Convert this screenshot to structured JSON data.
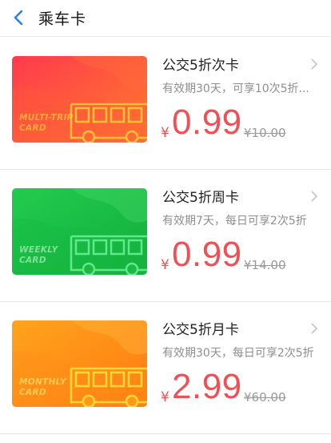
{
  "header": {
    "title": "乘车卡"
  },
  "cards": [
    {
      "name": "公交5折次卡",
      "description": "有效期30天，可享10次5折...",
      "currency": "¥",
      "price": "0.99",
      "original_price": "¥10.00",
      "card_label": "MULTI-TRIP\nCARD",
      "colors": {
        "start": "#ff3f4c",
        "end": "#ff7b2a",
        "bus": "#ffd23a",
        "label": "#ffdd3c"
      }
    },
    {
      "name": "公交5折周卡",
      "description": "有效期7天，每日可享2次5折",
      "currency": "¥",
      "price": "0.99",
      "original_price": "¥14.00",
      "card_label": "WEEKLY\nCARD",
      "colors": {
        "start": "#1ec94b",
        "end": "#15b23e",
        "bus": "#6df29a",
        "label": "#b8f7c9"
      }
    },
    {
      "name": "公交5折月卡",
      "description": "有效期30天，每日可享2次5折",
      "currency": "¥",
      "price": "2.99",
      "original_price": "¥60.00",
      "card_label": "MONTHLY\nCARD",
      "colors": {
        "start": "#ffa21b",
        "end": "#ff7d12",
        "bus": "#ffe13a",
        "label": "#fff06a"
      }
    }
  ]
}
